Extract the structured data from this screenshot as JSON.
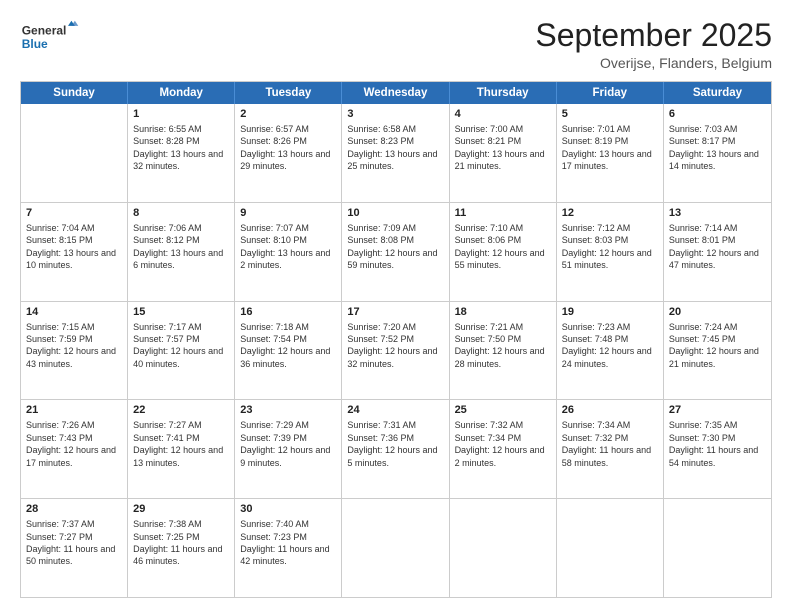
{
  "logo": {
    "line1": "General",
    "line2": "Blue"
  },
  "header": {
    "title": "September 2025",
    "subtitle": "Overijse, Flanders, Belgium"
  },
  "days": [
    "Sunday",
    "Monday",
    "Tuesday",
    "Wednesday",
    "Thursday",
    "Friday",
    "Saturday"
  ],
  "weeks": [
    [
      {
        "day": "",
        "sunrise": "",
        "sunset": "",
        "daylight": ""
      },
      {
        "day": "1",
        "sunrise": "Sunrise: 6:55 AM",
        "sunset": "Sunset: 8:28 PM",
        "daylight": "Daylight: 13 hours and 32 minutes."
      },
      {
        "day": "2",
        "sunrise": "Sunrise: 6:57 AM",
        "sunset": "Sunset: 8:26 PM",
        "daylight": "Daylight: 13 hours and 29 minutes."
      },
      {
        "day": "3",
        "sunrise": "Sunrise: 6:58 AM",
        "sunset": "Sunset: 8:23 PM",
        "daylight": "Daylight: 13 hours and 25 minutes."
      },
      {
        "day": "4",
        "sunrise": "Sunrise: 7:00 AM",
        "sunset": "Sunset: 8:21 PM",
        "daylight": "Daylight: 13 hours and 21 minutes."
      },
      {
        "day": "5",
        "sunrise": "Sunrise: 7:01 AM",
        "sunset": "Sunset: 8:19 PM",
        "daylight": "Daylight: 13 hours and 17 minutes."
      },
      {
        "day": "6",
        "sunrise": "Sunrise: 7:03 AM",
        "sunset": "Sunset: 8:17 PM",
        "daylight": "Daylight: 13 hours and 14 minutes."
      }
    ],
    [
      {
        "day": "7",
        "sunrise": "Sunrise: 7:04 AM",
        "sunset": "Sunset: 8:15 PM",
        "daylight": "Daylight: 13 hours and 10 minutes."
      },
      {
        "day": "8",
        "sunrise": "Sunrise: 7:06 AM",
        "sunset": "Sunset: 8:12 PM",
        "daylight": "Daylight: 13 hours and 6 minutes."
      },
      {
        "day": "9",
        "sunrise": "Sunrise: 7:07 AM",
        "sunset": "Sunset: 8:10 PM",
        "daylight": "Daylight: 13 hours and 2 minutes."
      },
      {
        "day": "10",
        "sunrise": "Sunrise: 7:09 AM",
        "sunset": "Sunset: 8:08 PM",
        "daylight": "Daylight: 12 hours and 59 minutes."
      },
      {
        "day": "11",
        "sunrise": "Sunrise: 7:10 AM",
        "sunset": "Sunset: 8:06 PM",
        "daylight": "Daylight: 12 hours and 55 minutes."
      },
      {
        "day": "12",
        "sunrise": "Sunrise: 7:12 AM",
        "sunset": "Sunset: 8:03 PM",
        "daylight": "Daylight: 12 hours and 51 minutes."
      },
      {
        "day": "13",
        "sunrise": "Sunrise: 7:14 AM",
        "sunset": "Sunset: 8:01 PM",
        "daylight": "Daylight: 12 hours and 47 minutes."
      }
    ],
    [
      {
        "day": "14",
        "sunrise": "Sunrise: 7:15 AM",
        "sunset": "Sunset: 7:59 PM",
        "daylight": "Daylight: 12 hours and 43 minutes."
      },
      {
        "day": "15",
        "sunrise": "Sunrise: 7:17 AM",
        "sunset": "Sunset: 7:57 PM",
        "daylight": "Daylight: 12 hours and 40 minutes."
      },
      {
        "day": "16",
        "sunrise": "Sunrise: 7:18 AM",
        "sunset": "Sunset: 7:54 PM",
        "daylight": "Daylight: 12 hours and 36 minutes."
      },
      {
        "day": "17",
        "sunrise": "Sunrise: 7:20 AM",
        "sunset": "Sunset: 7:52 PM",
        "daylight": "Daylight: 12 hours and 32 minutes."
      },
      {
        "day": "18",
        "sunrise": "Sunrise: 7:21 AM",
        "sunset": "Sunset: 7:50 PM",
        "daylight": "Daylight: 12 hours and 28 minutes."
      },
      {
        "day": "19",
        "sunrise": "Sunrise: 7:23 AM",
        "sunset": "Sunset: 7:48 PM",
        "daylight": "Daylight: 12 hours and 24 minutes."
      },
      {
        "day": "20",
        "sunrise": "Sunrise: 7:24 AM",
        "sunset": "Sunset: 7:45 PM",
        "daylight": "Daylight: 12 hours and 21 minutes."
      }
    ],
    [
      {
        "day": "21",
        "sunrise": "Sunrise: 7:26 AM",
        "sunset": "Sunset: 7:43 PM",
        "daylight": "Daylight: 12 hours and 17 minutes."
      },
      {
        "day": "22",
        "sunrise": "Sunrise: 7:27 AM",
        "sunset": "Sunset: 7:41 PM",
        "daylight": "Daylight: 12 hours and 13 minutes."
      },
      {
        "day": "23",
        "sunrise": "Sunrise: 7:29 AM",
        "sunset": "Sunset: 7:39 PM",
        "daylight": "Daylight: 12 hours and 9 minutes."
      },
      {
        "day": "24",
        "sunrise": "Sunrise: 7:31 AM",
        "sunset": "Sunset: 7:36 PM",
        "daylight": "Daylight: 12 hours and 5 minutes."
      },
      {
        "day": "25",
        "sunrise": "Sunrise: 7:32 AM",
        "sunset": "Sunset: 7:34 PM",
        "daylight": "Daylight: 12 hours and 2 minutes."
      },
      {
        "day": "26",
        "sunrise": "Sunrise: 7:34 AM",
        "sunset": "Sunset: 7:32 PM",
        "daylight": "Daylight: 11 hours and 58 minutes."
      },
      {
        "day": "27",
        "sunrise": "Sunrise: 7:35 AM",
        "sunset": "Sunset: 7:30 PM",
        "daylight": "Daylight: 11 hours and 54 minutes."
      }
    ],
    [
      {
        "day": "28",
        "sunrise": "Sunrise: 7:37 AM",
        "sunset": "Sunset: 7:27 PM",
        "daylight": "Daylight: 11 hours and 50 minutes."
      },
      {
        "day": "29",
        "sunrise": "Sunrise: 7:38 AM",
        "sunset": "Sunset: 7:25 PM",
        "daylight": "Daylight: 11 hours and 46 minutes."
      },
      {
        "day": "30",
        "sunrise": "Sunrise: 7:40 AM",
        "sunset": "Sunset: 7:23 PM",
        "daylight": "Daylight: 11 hours and 42 minutes."
      },
      {
        "day": "",
        "sunrise": "",
        "sunset": "",
        "daylight": ""
      },
      {
        "day": "",
        "sunrise": "",
        "sunset": "",
        "daylight": ""
      },
      {
        "day": "",
        "sunrise": "",
        "sunset": "",
        "daylight": ""
      },
      {
        "day": "",
        "sunrise": "",
        "sunset": "",
        "daylight": ""
      }
    ]
  ]
}
